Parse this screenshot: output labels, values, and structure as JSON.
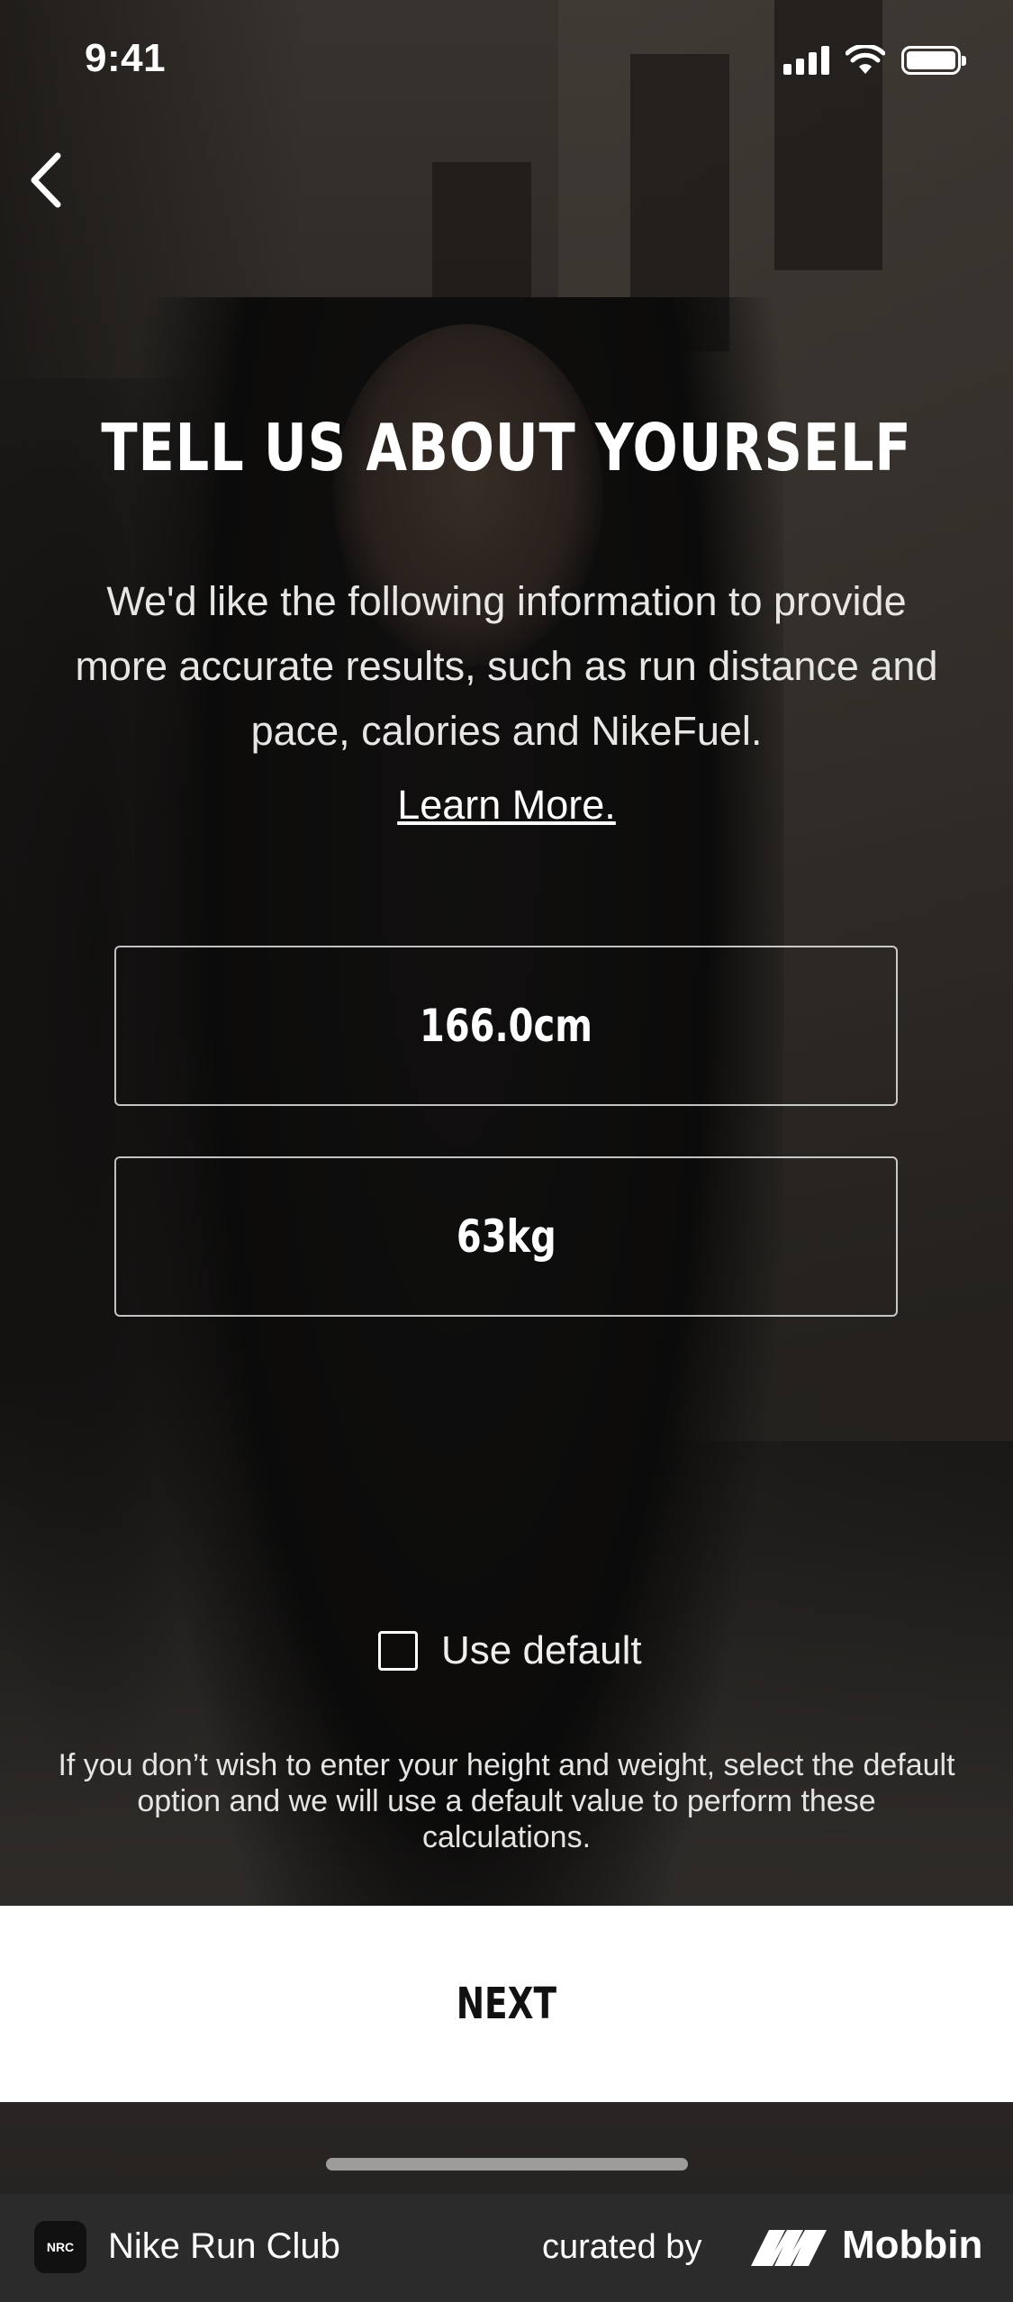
{
  "status_bar": {
    "time": "9:41"
  },
  "screen": {
    "title": "TELL US ABOUT YOURSELF",
    "description": "We'd like the following information to provide more accurate results, such as run distance and pace, calories and NikeFuel.",
    "learn_more": "Learn More.",
    "height_value": "166.0cm",
    "weight_value": "63kg",
    "use_default_label": "Use default",
    "use_default_checked": false,
    "default_note": "If you don’t wish to enter your height and weight, select the default option and we will use a default value to perform these calculations.",
    "next_label": "NEXT"
  },
  "footer": {
    "app_icon_text": "NRC",
    "app_name": "Nike Run Club",
    "curated_by": "curated by",
    "brand": "Mobbin"
  }
}
